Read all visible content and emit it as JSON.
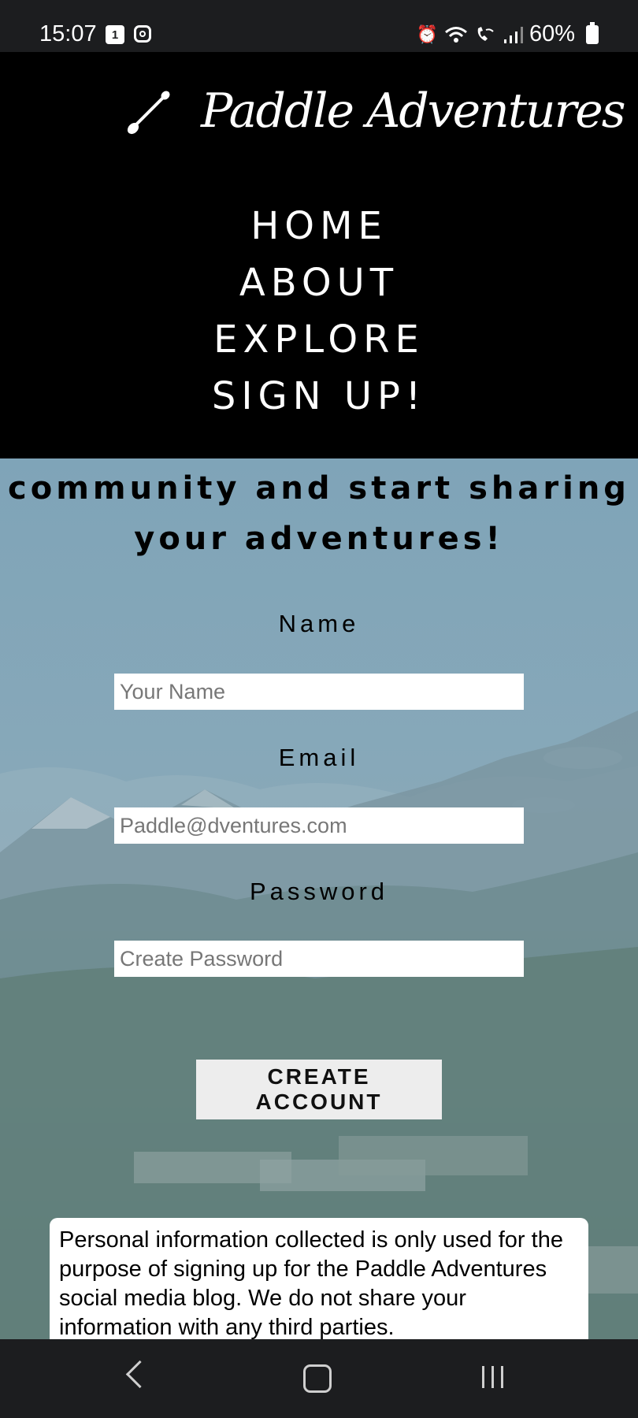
{
  "status_bar": {
    "time": "15:07",
    "calendar_badge": "1",
    "battery": "60%"
  },
  "header": {
    "brand": "Paddle Adventures",
    "nav": [
      "HOME",
      "ABOUT",
      "EXPLORE",
      "SIGN UP!"
    ]
  },
  "signup": {
    "headline_line1": "community and start sharing",
    "headline_line2": "your adventures!",
    "name_label": "Name",
    "name_placeholder": "Your Name",
    "email_label": "Email",
    "email_placeholder": "Paddle@dventures.com",
    "password_label": "Password",
    "password_placeholder": "Create Password",
    "submit": "CREATE ACCOUNT",
    "privacy_notice": "Personal information collected is only used for the purpose of signing up for the Paddle Adventures social media blog. We do not share your information with any third parties."
  },
  "icons": [
    "calendar-icon",
    "instagram-icon",
    "alarm-icon",
    "wifi-icon",
    "wifi-calling-icon",
    "signal-icon",
    "battery-icon",
    "paddle-icon",
    "back-icon",
    "home-icon",
    "recent-apps-icon"
  ]
}
